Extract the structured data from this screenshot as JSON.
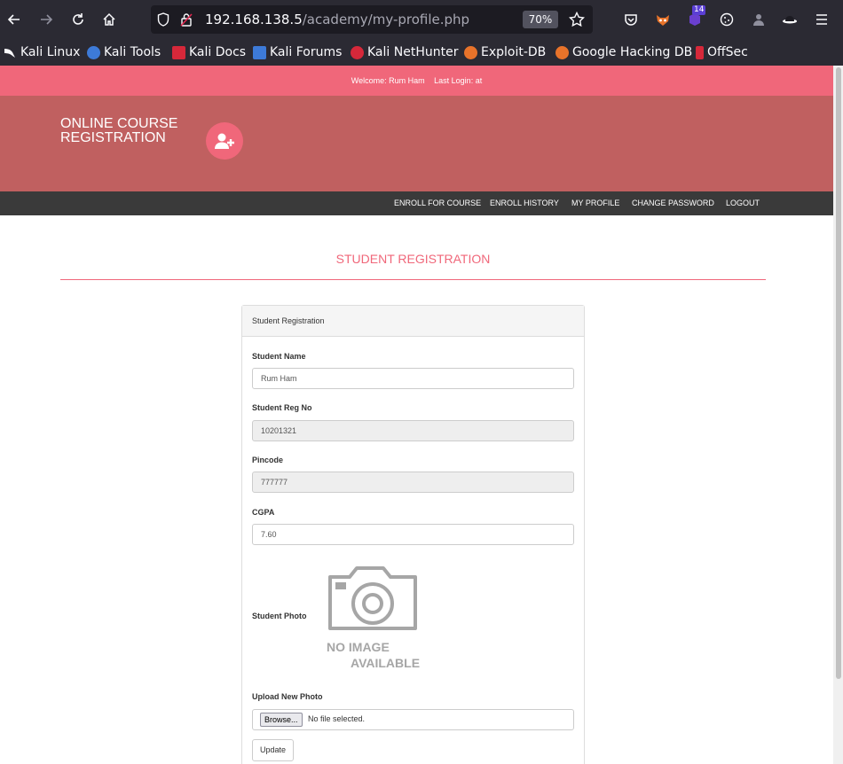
{
  "browser": {
    "url_host": "192.168.138.5",
    "url_path": "/academy/my-profile.php",
    "zoom": "70%",
    "extension_badge": "14",
    "bookmarks": [
      {
        "label": "Kali Linux",
        "color": "#4a6fa5"
      },
      {
        "label": "Kali Tools",
        "color": "#3d7ad8"
      },
      {
        "label": "Kali Docs",
        "color": "#d6283a"
      },
      {
        "label": "Kali Forums",
        "color": "#3d7ad8"
      },
      {
        "label": "Kali NetHunter",
        "color": "#d6283a"
      },
      {
        "label": "Exploit-DB",
        "color": "#e8732a"
      },
      {
        "label": "Google Hacking DB",
        "color": "#e8732a"
      },
      {
        "label": "OffSec",
        "color": "#d6283a"
      }
    ]
  },
  "topbar": {
    "welcome": "Welcome: Rum Ham",
    "last_login": "Last Login: at"
  },
  "header": {
    "brand_line1": "ONLINE COURSE",
    "brand_line2": "REGISTRATION"
  },
  "nav": {
    "items": [
      "ENROLL FOR COURSE",
      "ENROLL HISTORY",
      "MY PROFILE",
      "CHANGE PASSWORD",
      "LOGOUT"
    ]
  },
  "page": {
    "title": "STUDENT REGISTRATION"
  },
  "form": {
    "panel_title": "Student Registration",
    "name_label": "Student Name",
    "name_value": "Rum Ham",
    "regno_label": "Student Reg No",
    "regno_value": "10201321",
    "pincode_label": "Pincode",
    "pincode_value": "777777",
    "cgpa_label": "CGPA",
    "cgpa_value": "7.60",
    "photo_label": "Student Photo",
    "no_image_line1": "NO IMAGE",
    "no_image_line2": "AVAILABLE",
    "upload_label": "Upload New Photo",
    "browse_label": "Browse...",
    "file_status": "No file selected.",
    "update_label": "Update"
  },
  "colors": {
    "accent_pink": "#f0677a",
    "header_red": "#c06060",
    "nav_dark": "#3a3a3a"
  }
}
